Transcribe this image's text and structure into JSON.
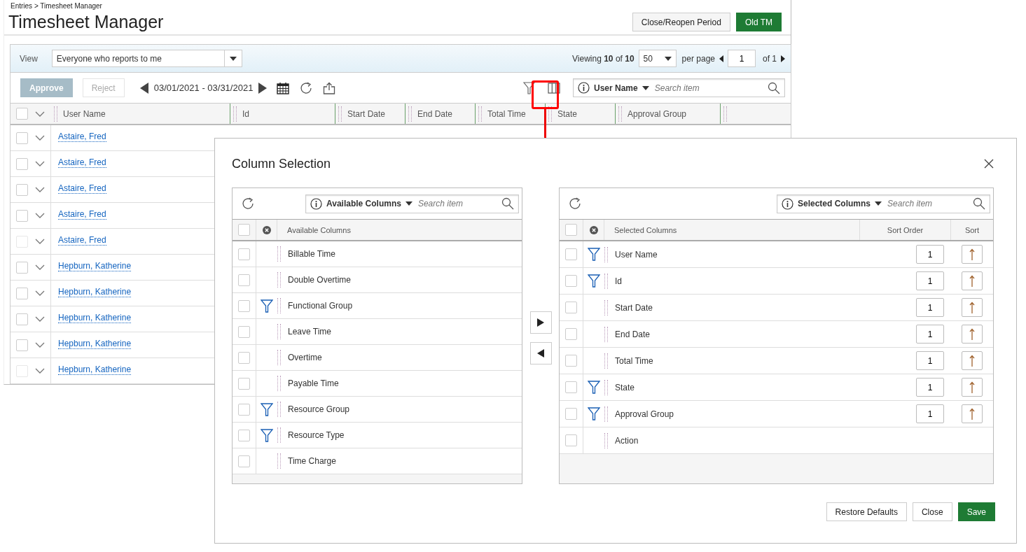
{
  "breadcrumb": "Entries > Timesheet Manager",
  "title": "Timesheet Manager",
  "header_buttons": [
    {
      "label": "Close/Reopen Period",
      "kind": "secondary"
    },
    {
      "label": "Old TM",
      "kind": "primary"
    }
  ],
  "view": {
    "label": "View",
    "value": "Everyone who reports to me"
  },
  "pager": {
    "viewing_label": "Viewing",
    "shown": "10",
    "of_label": "of",
    "total": "10",
    "per_page_value": "50",
    "per_page_label": "per page",
    "page": "1",
    "page_of": "of 1"
  },
  "actions": [
    {
      "label": "Approve",
      "kind": "primary",
      "disabled": true
    },
    {
      "label": "Reject",
      "kind": "secondary",
      "disabled": true
    }
  ],
  "date_range": "03/01/2021 - 03/31/2021",
  "search": {
    "field": "User Name",
    "placeholder": "Search item"
  },
  "table": {
    "select_all_checked": false,
    "columns": [
      "User Name",
      "Id",
      "Start Date",
      "End Date",
      "Total Time",
      "State",
      "Approval Group"
    ],
    "rows": [
      {
        "user": "Astaire, Fred",
        "checked": false,
        "disabled": false
      },
      {
        "user": "Astaire, Fred",
        "checked": false,
        "disabled": false
      },
      {
        "user": "Astaire, Fred",
        "checked": false,
        "disabled": false
      },
      {
        "user": "Astaire, Fred",
        "checked": false,
        "disabled": false
      },
      {
        "user": "Astaire, Fred",
        "checked": false,
        "disabled": true
      },
      {
        "user": "Hepburn, Katherine",
        "checked": false,
        "disabled": false
      },
      {
        "user": "Hepburn, Katherine",
        "checked": false,
        "disabled": false
      },
      {
        "user": "Hepburn, Katherine",
        "checked": false,
        "disabled": false
      },
      {
        "user": "Hepburn, Katherine",
        "checked": false,
        "disabled": false
      },
      {
        "user": "Hepburn, Katherine",
        "checked": false,
        "disabled": true
      }
    ]
  },
  "dialog": {
    "title": "Column Selection",
    "available": {
      "select_all_checked": false,
      "search_field": "Available Columns",
      "placeholder": "Search item",
      "header": "Available Columns",
      "items": [
        {
          "label": "Billable Time",
          "checked": false,
          "filterable": false
        },
        {
          "label": "Double Overtime",
          "checked": false,
          "filterable": false
        },
        {
          "label": "Functional Group",
          "checked": false,
          "filterable": true
        },
        {
          "label": "Leave Time",
          "checked": false,
          "filterable": false
        },
        {
          "label": "Overtime",
          "checked": false,
          "filterable": false
        },
        {
          "label": "Payable Time",
          "checked": false,
          "filterable": false
        },
        {
          "label": "Resource Group",
          "checked": false,
          "filterable": true
        },
        {
          "label": "Resource Type",
          "checked": false,
          "filterable": true
        },
        {
          "label": "Time Charge",
          "checked": false,
          "filterable": false
        }
      ]
    },
    "selected": {
      "select_all_checked": false,
      "search_field": "Selected Columns",
      "placeholder": "Search item",
      "header": "Selected Columns",
      "sort_order_header": "Sort Order",
      "sort_header": "Sort",
      "items": [
        {
          "label": "User Name",
          "checked": false,
          "filterable": true,
          "sort_order": "1"
        },
        {
          "label": "Id",
          "checked": false,
          "filterable": true,
          "sort_order": "1"
        },
        {
          "label": "Start Date",
          "checked": false,
          "filterable": false,
          "sort_order": "1"
        },
        {
          "label": "End Date",
          "checked": false,
          "filterable": false,
          "sort_order": "1"
        },
        {
          "label": "Total Time",
          "checked": false,
          "filterable": false,
          "sort_order": "1"
        },
        {
          "label": "State",
          "checked": false,
          "filterable": true,
          "sort_order": "1"
        },
        {
          "label": "Approval Group",
          "checked": false,
          "filterable": true,
          "sort_order": "1"
        },
        {
          "label": "Action",
          "checked": false,
          "filterable": false
        }
      ]
    },
    "buttons": [
      {
        "label": "Restore Defaults",
        "kind": "secondary"
      },
      {
        "label": "Close",
        "kind": "secondary"
      },
      {
        "label": "Save",
        "kind": "primary"
      }
    ]
  }
}
